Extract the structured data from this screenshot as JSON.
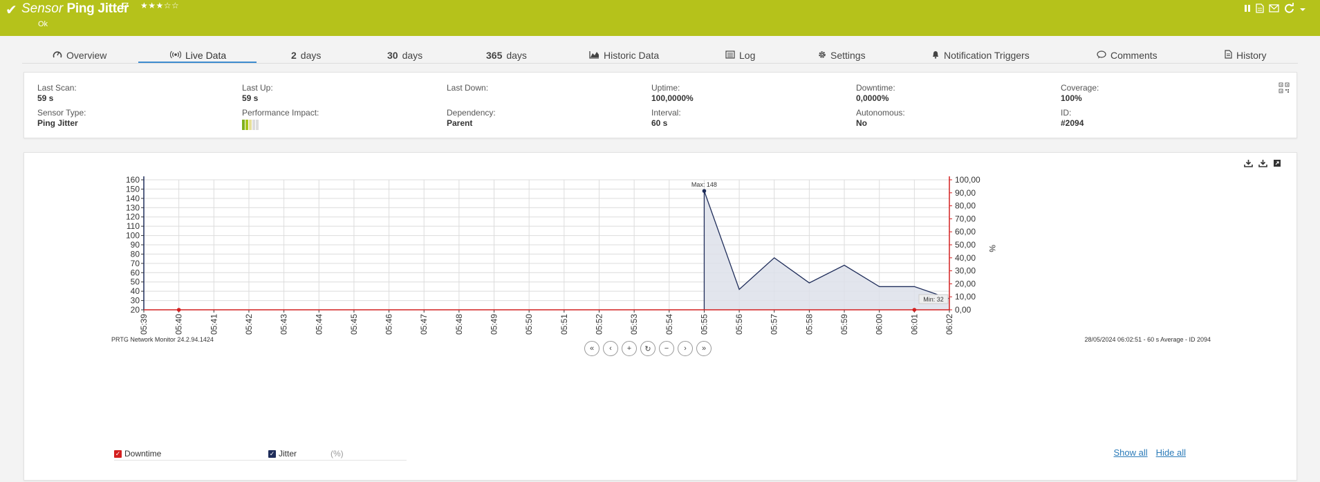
{
  "header": {
    "title_prefix": "Sensor",
    "title_name": "Ping Jitter",
    "stars": "★★★☆☆",
    "status": "Ok",
    "tools": [
      "pause-icon",
      "report-icon",
      "email-icon",
      "refresh-icon",
      "dropdown-icon"
    ]
  },
  "tabs": [
    {
      "icon": "gauge-icon",
      "label": "Overview"
    },
    {
      "icon": "live-icon",
      "label": "Live Data"
    },
    {
      "num": "2",
      "label": "days"
    },
    {
      "num": "30",
      "label": "days"
    },
    {
      "num": "365",
      "label": "days"
    },
    {
      "icon": "area-chart-icon",
      "label": "Historic Data"
    },
    {
      "icon": "log-icon",
      "label": "Log"
    },
    {
      "icon": "gear-icon",
      "label": "Settings"
    },
    {
      "icon": "bell-icon",
      "label": "Notification Triggers"
    },
    {
      "icon": "comment-icon",
      "label": "Comments"
    },
    {
      "icon": "history-icon",
      "label": "History"
    }
  ],
  "info": {
    "last_scan": {
      "label": "Last Scan:",
      "value": "59 s"
    },
    "last_up": {
      "label": "Last Up:",
      "value": "59 s"
    },
    "last_down": {
      "label": "Last Down:",
      "value": ""
    },
    "uptime": {
      "label": "Uptime:",
      "value": "100,0000%"
    },
    "downtime": {
      "label": "Downtime:",
      "value": "0,0000%"
    },
    "coverage": {
      "label": "Coverage:",
      "value": "100%"
    },
    "sensor_type": {
      "label": "Sensor Type:",
      "value": "Ping Jitter"
    },
    "performance_impact": {
      "label": "Performance Impact:",
      "level": 2,
      "max": 5
    },
    "dependency": {
      "label": "Dependency:",
      "value": "Parent"
    },
    "interval": {
      "label": "Interval:",
      "value": "60 s"
    },
    "autonomous": {
      "label": "Autonomous:",
      "value": "No"
    },
    "id": {
      "label": "ID:",
      "value": "#2094"
    }
  },
  "chart_data": {
    "type": "area",
    "x": [
      "05:39",
      "05:40",
      "05:41",
      "05:42",
      "05:43",
      "05:44",
      "05:45",
      "05:46",
      "05:47",
      "05:48",
      "05:49",
      "05:50",
      "05:51",
      "05:52",
      "05:53",
      "05:54",
      "05:55",
      "05:56",
      "05:57",
      "05:58",
      "05:59",
      "06:00",
      "06:01",
      "06:02"
    ],
    "series": [
      {
        "name": "Jitter",
        "axis": "left",
        "color": "#1f2d5a",
        "values": [
          null,
          null,
          null,
          null,
          null,
          null,
          null,
          null,
          null,
          null,
          null,
          null,
          null,
          null,
          null,
          null,
          148,
          42,
          76,
          49,
          68,
          45,
          45,
          32
        ]
      },
      {
        "name": "Downtime",
        "axis": "right",
        "color": "#d42020",
        "values": [
          0,
          0,
          0,
          0,
          0,
          0,
          0,
          0,
          0,
          0,
          0,
          0,
          0,
          0,
          0,
          0,
          0,
          0,
          0,
          0,
          0,
          0,
          0,
          0
        ]
      }
    ],
    "yleft": {
      "min": 20,
      "max": 160,
      "ticks": [
        "160",
        "150",
        "140",
        "130",
        "120",
        "110",
        "100",
        "90",
        "80",
        "70",
        "60",
        "50",
        "40",
        "30",
        "20"
      ]
    },
    "yright": {
      "min": 0,
      "max": 100,
      "label": "%",
      "ticks": [
        "100,00",
        "90,00",
        "80,00",
        "70,00",
        "60,00",
        "50,00",
        "40,00",
        "30,00",
        "20,00",
        "10,00",
        "0,00"
      ]
    },
    "annotations": {
      "max": "Max: 148",
      "min": "Min: 32"
    },
    "footer_left": "PRTG Network Monitor 24.2.94.1424",
    "footer_right": "28/05/2024 06:02:51 - 60 s Average - ID 2094"
  },
  "legend": [
    {
      "name": "Downtime",
      "unit": "(%)",
      "color": "#d42020",
      "checked": true
    },
    {
      "name": "Jitter",
      "unit": "",
      "color": "#1f2d5a",
      "checked": true
    }
  ],
  "links": {
    "show_all": "Show all",
    "hide_all": "Hide all"
  },
  "nav": [
    "first-icon",
    "prev-icon",
    "zoom-in-icon",
    "reset-icon",
    "zoom-out-icon",
    "next-icon",
    "last-icon"
  ],
  "colors": {
    "header": "#b5c21b",
    "accent": "#3d8ccf",
    "downtime": "#d42020",
    "jitter": "#1f2d5a"
  }
}
